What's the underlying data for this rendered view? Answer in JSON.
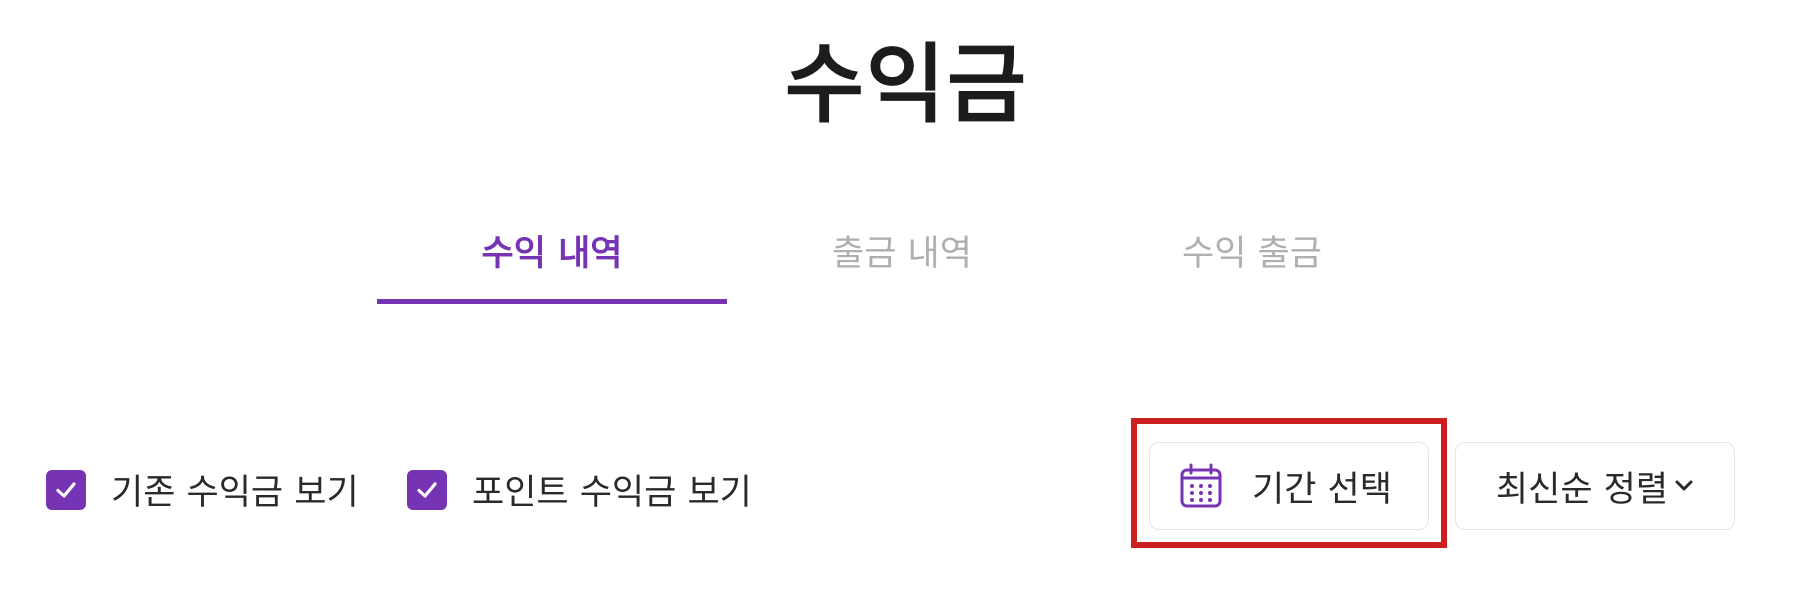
{
  "page": {
    "title": "수익금"
  },
  "tabs": [
    {
      "label": "수익 내역",
      "active": true
    },
    {
      "label": "출금 내역",
      "active": false
    },
    {
      "label": "수익 출금",
      "active": false
    }
  ],
  "filters": {
    "existing_revenue": {
      "label": "기존 수익금 보기",
      "checked": true
    },
    "point_revenue": {
      "label": "포인트 수익금 보기",
      "checked": true
    }
  },
  "date_picker": {
    "label": "기간 선택",
    "icon": "calendar-icon"
  },
  "sort": {
    "label": "최신순 정렬",
    "icon": "chevron-down-icon"
  },
  "colors": {
    "accent": "#7634b5",
    "inactive_tab": "#aeaeb3",
    "highlight": "#cc1f1f"
  }
}
